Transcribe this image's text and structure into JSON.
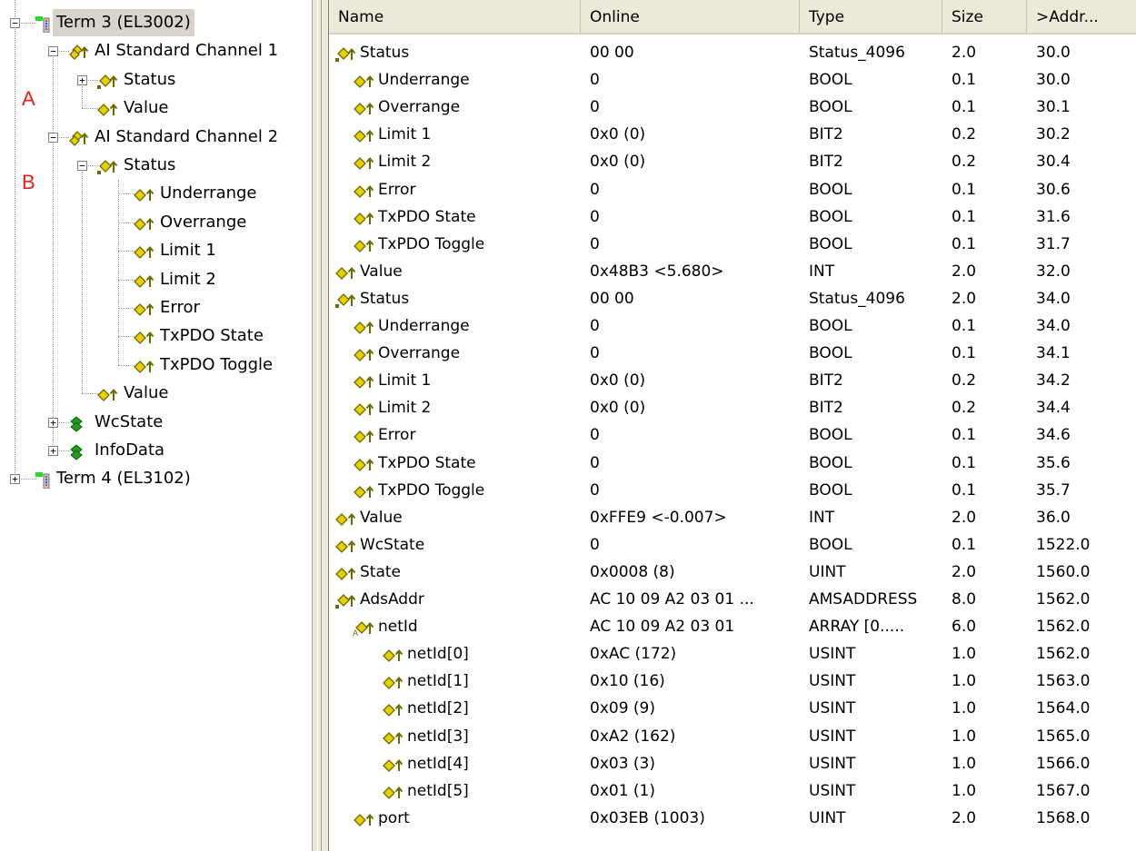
{
  "colors": {
    "selection_bg": "#d8d4cc",
    "marker_red": "#e8201b",
    "icon_yellow": "#e8d000",
    "icon_olive": "#6b6b00",
    "icon_green": "#1e9c1e",
    "header_bg": "#ece9d8"
  },
  "tree": [
    {
      "label": "Term 3 (EL3002)",
      "level": 0,
      "expander": "minus",
      "icon": "terminal-icon",
      "selected": true
    },
    {
      "label": "AI Standard Channel 1",
      "level": 1,
      "expander": "minus",
      "icon": "channel-icon"
    },
    {
      "label": "Status",
      "level": 2,
      "expander": "plus",
      "icon": "struct-var-icon"
    },
    {
      "label": "Value",
      "level": 2,
      "expander": "none",
      "icon": "input-var-icon"
    },
    {
      "label": "AI Standard Channel 2",
      "level": 1,
      "expander": "minus",
      "icon": "channel-icon"
    },
    {
      "label": "Status",
      "level": 2,
      "expander": "minus",
      "icon": "struct-var-icon"
    },
    {
      "label": "Underrange",
      "level": 3,
      "expander": "none",
      "icon": "input-var-icon"
    },
    {
      "label": "Overrange",
      "level": 3,
      "expander": "none",
      "icon": "input-var-icon"
    },
    {
      "label": "Limit 1",
      "level": 3,
      "expander": "none",
      "icon": "input-var-icon"
    },
    {
      "label": "Limit 2",
      "level": 3,
      "expander": "none",
      "icon": "input-var-icon"
    },
    {
      "label": "Error",
      "level": 3,
      "expander": "none",
      "icon": "input-var-icon"
    },
    {
      "label": "TxPDO State",
      "level": 3,
      "expander": "none",
      "icon": "input-var-icon"
    },
    {
      "label": "TxPDO Toggle",
      "level": 3,
      "expander": "none",
      "icon": "input-var-icon"
    },
    {
      "label": "Value",
      "level": 2,
      "expander": "none",
      "icon": "input-var-icon"
    },
    {
      "label": "WcState",
      "level": 1,
      "expander": "plus",
      "icon": "green-group-icon"
    },
    {
      "label": "InfoData",
      "level": 1,
      "expander": "plus",
      "icon": "green-group-icon"
    },
    {
      "label": "Term 4 (EL3102)",
      "level": 0,
      "expander": "plus",
      "icon": "terminal-icon"
    }
  ],
  "markers": [
    "A",
    "B"
  ],
  "columns": [
    "Name",
    "Online",
    "Type",
    "Size",
    ">Addr..."
  ],
  "rows": [
    {
      "name": "Status",
      "indent": 0,
      "icon": "struct-var-icon",
      "online": "00 00",
      "type": "Status_4096",
      "size": "2.0",
      "addr": "30.0"
    },
    {
      "name": "Underrange",
      "indent": 1,
      "icon": "input-var-icon",
      "online": "0",
      "type": "BOOL",
      "size": "0.1",
      "addr": "30.0"
    },
    {
      "name": "Overrange",
      "indent": 1,
      "icon": "input-var-icon",
      "online": "0",
      "type": "BOOL",
      "size": "0.1",
      "addr": "30.1"
    },
    {
      "name": "Limit 1",
      "indent": 1,
      "icon": "input-var-icon",
      "online": "0x0 (0)",
      "type": "BIT2",
      "size": "0.2",
      "addr": "30.2"
    },
    {
      "name": "Limit 2",
      "indent": 1,
      "icon": "input-var-icon",
      "online": "0x0 (0)",
      "type": "BIT2",
      "size": "0.2",
      "addr": "30.4"
    },
    {
      "name": "Error",
      "indent": 1,
      "icon": "input-var-icon",
      "online": "0",
      "type": "BOOL",
      "size": "0.1",
      "addr": "30.6"
    },
    {
      "name": "TxPDO State",
      "indent": 1,
      "icon": "input-var-icon",
      "online": "0",
      "type": "BOOL",
      "size": "0.1",
      "addr": "31.6"
    },
    {
      "name": "TxPDO Toggle",
      "indent": 1,
      "icon": "input-var-icon",
      "online": "0",
      "type": "BOOL",
      "size": "0.1",
      "addr": "31.7"
    },
    {
      "name": "Value",
      "indent": 0,
      "icon": "input-var-icon",
      "online": "0x48B3 <5.680>",
      "type": "INT",
      "size": "2.0",
      "addr": "32.0"
    },
    {
      "name": "Status",
      "indent": 0,
      "icon": "struct-var-icon",
      "online": "00 00",
      "type": "Status_4096",
      "size": "2.0",
      "addr": "34.0"
    },
    {
      "name": "Underrange",
      "indent": 1,
      "icon": "input-var-icon",
      "online": "0",
      "type": "BOOL",
      "size": "0.1",
      "addr": "34.0"
    },
    {
      "name": "Overrange",
      "indent": 1,
      "icon": "input-var-icon",
      "online": "0",
      "type": "BOOL",
      "size": "0.1",
      "addr": "34.1"
    },
    {
      "name": "Limit 1",
      "indent": 1,
      "icon": "input-var-icon",
      "online": "0x0 (0)",
      "type": "BIT2",
      "size": "0.2",
      "addr": "34.2"
    },
    {
      "name": "Limit 2",
      "indent": 1,
      "icon": "input-var-icon",
      "online": "0x0 (0)",
      "type": "BIT2",
      "size": "0.2",
      "addr": "34.4"
    },
    {
      "name": "Error",
      "indent": 1,
      "icon": "input-var-icon",
      "online": "0",
      "type": "BOOL",
      "size": "0.1",
      "addr": "34.6"
    },
    {
      "name": "TxPDO State",
      "indent": 1,
      "icon": "input-var-icon",
      "online": "0",
      "type": "BOOL",
      "size": "0.1",
      "addr": "35.6"
    },
    {
      "name": "TxPDO Toggle",
      "indent": 1,
      "icon": "input-var-icon",
      "online": "0",
      "type": "BOOL",
      "size": "0.1",
      "addr": "35.7"
    },
    {
      "name": "Value",
      "indent": 0,
      "icon": "input-var-icon",
      "online": "0xFFE9 <-0.007>",
      "type": "INT",
      "size": "2.0",
      "addr": "36.0"
    },
    {
      "name": "WcState",
      "indent": 0,
      "icon": "input-var-icon",
      "online": "0",
      "type": "BOOL",
      "size": "0.1",
      "addr": "1522.0"
    },
    {
      "name": "State",
      "indent": 0,
      "icon": "input-var-icon",
      "online": "0x0008 (8)",
      "type": "UINT",
      "size": "2.0",
      "addr": "1560.0"
    },
    {
      "name": "AdsAddr",
      "indent": 0,
      "icon": "struct-var-icon",
      "online": "AC 10 09 A2 03 01 ...",
      "type": "AMSADDRESS",
      "size": "8.0",
      "addr": "1562.0"
    },
    {
      "name": "netId",
      "indent": 1,
      "icon": "array-var-icon",
      "online": "AC 10 09 A2 03 01",
      "type": "ARRAY [0.....",
      "size": "6.0",
      "addr": "1562.0"
    },
    {
      "name": "netId[0]",
      "indent": 2,
      "icon": "input-var-icon",
      "online": "0xAC (172)",
      "type": "USINT",
      "size": "1.0",
      "addr": "1562.0"
    },
    {
      "name": "netId[1]",
      "indent": 2,
      "icon": "input-var-icon",
      "online": "0x10 (16)",
      "type": "USINT",
      "size": "1.0",
      "addr": "1563.0"
    },
    {
      "name": "netId[2]",
      "indent": 2,
      "icon": "input-var-icon",
      "online": "0x09 (9)",
      "type": "USINT",
      "size": "1.0",
      "addr": "1564.0"
    },
    {
      "name": "netId[3]",
      "indent": 2,
      "icon": "input-var-icon",
      "online": "0xA2 (162)",
      "type": "USINT",
      "size": "1.0",
      "addr": "1565.0"
    },
    {
      "name": "netId[4]",
      "indent": 2,
      "icon": "input-var-icon",
      "online": "0x03 (3)",
      "type": "USINT",
      "size": "1.0",
      "addr": "1566.0"
    },
    {
      "name": "netId[5]",
      "indent": 2,
      "icon": "input-var-icon",
      "online": "0x01 (1)",
      "type": "USINT",
      "size": "1.0",
      "addr": "1567.0"
    },
    {
      "name": "port",
      "indent": 1,
      "icon": "input-var-icon",
      "online": "0x03EB (1003)",
      "type": "UINT",
      "size": "2.0",
      "addr": "1568.0"
    }
  ]
}
